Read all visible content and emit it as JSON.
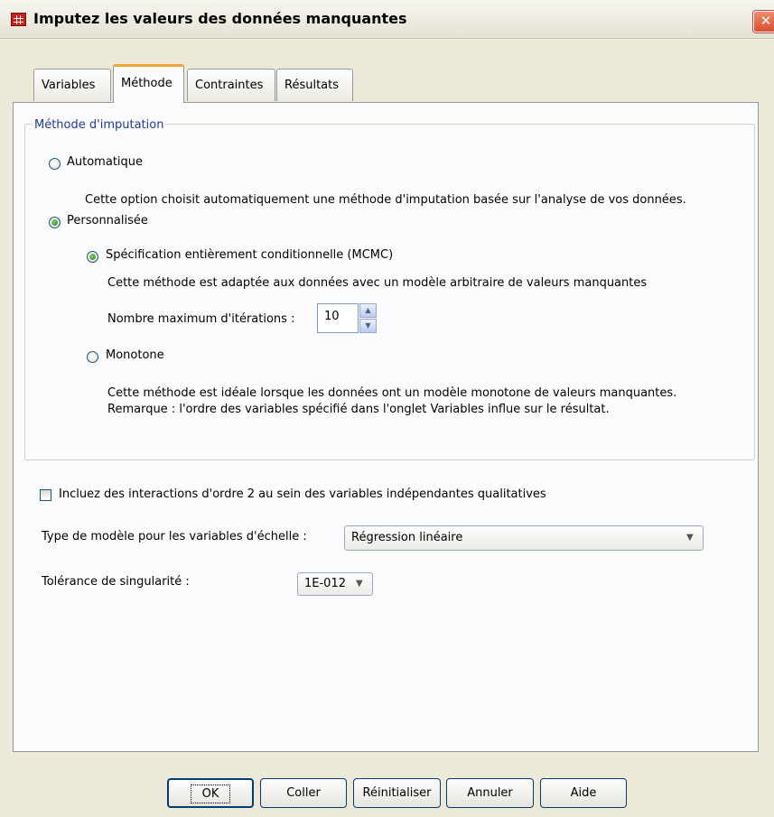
{
  "window": {
    "title": "Imputez les valeurs des données manquantes",
    "close_glyph": "✕"
  },
  "tabs": [
    {
      "label": "Variables"
    },
    {
      "label": "Méthode"
    },
    {
      "label": "Contraintes"
    },
    {
      "label": "Résultats"
    }
  ],
  "active_tab": "Méthode",
  "imputation_method": {
    "group_label": "Méthode d'imputation",
    "automatic": {
      "label": "Automatique",
      "checked": false,
      "description": "Cette option choisit automatiquement une méthode d'imputation basée sur l'analyse de vos données."
    },
    "custom": {
      "label": "Personnalisée",
      "checked": true,
      "fcs": {
        "label": "Spécification entièrement conditionnelle (MCMC)",
        "checked": true,
        "description": "Cette méthode est adaptée aux données avec un modèle arbitraire de valeurs manquantes",
        "max_iterations_label": "Nombre maximum d'itérations :",
        "max_iterations_value": "10"
      },
      "monotone": {
        "label": "Monotone",
        "checked": false,
        "description_line1": "Cette méthode est idéale lorsque les données ont un modèle monotone de valeurs manquantes.",
        "description_line2": "Remarque : l'ordre des variables spécifié dans l'onglet Variables influe sur le résultat."
      }
    }
  },
  "interactions_checkbox": {
    "label": "Incluez des interactions d'ordre 2 au sein des variables indépendantes qualitatives",
    "checked": false
  },
  "scale_model": {
    "label": "Type de modèle pour les variables d'échelle :",
    "value": "Régression linéaire"
  },
  "singularity": {
    "label": "Tolérance de singularité :",
    "value": "1E-012"
  },
  "buttons": {
    "ok": "OK",
    "paste": "Coller",
    "reset": "Réinitialiser",
    "cancel": "Annuler",
    "help": "Aide"
  },
  "colors": {
    "titlebar": "#ece9d8",
    "accent_tab": "#f2a33a",
    "group_label": "#1f3b8c",
    "close_button": "#d6502c"
  }
}
